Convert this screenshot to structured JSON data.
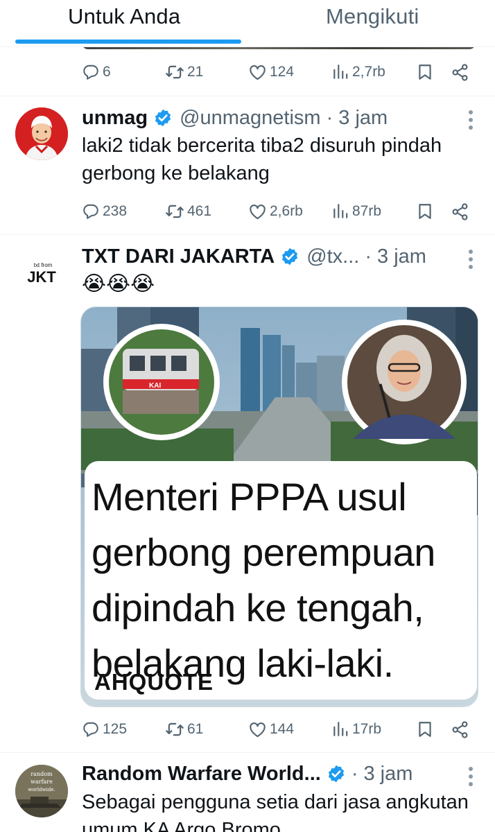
{
  "tabs": [
    {
      "label": "Untuk Anda",
      "active": true
    },
    {
      "label": "Mengikuti",
      "active": false
    }
  ],
  "accent_color": "#1d9bf0",
  "previous_tweet": {
    "actions": {
      "replies": "6",
      "retweets": "21",
      "likes": "124",
      "views": "2,7rb"
    }
  },
  "tweets": [
    {
      "display_name": "unmag",
      "verified": true,
      "handle": "@unmagnetism",
      "time": "3 jam",
      "text": "laki2 tidak bercerita tiba2 disuruh pindah gerbong ke belakang",
      "actions": {
        "replies": "238",
        "retweets": "461",
        "likes": "2,6rb",
        "views": "87rb"
      }
    },
    {
      "display_name": "TXT DARI JAKARTA",
      "verified": true,
      "handle": "@tx...",
      "time": "3 jam",
      "avatar_text": {
        "small": "txt from",
        "big": "JKT"
      },
      "text": "😭😭😭",
      "media": {
        "quote": "Menteri PPPA usul gerbong perempuan dipindah ke tengah, belakang laki-laki.",
        "brand": "AHQUOTE",
        "train_label": "KAI"
      },
      "actions": {
        "replies": "125",
        "retweets": "61",
        "likes": "144",
        "views": "17rb"
      }
    },
    {
      "display_name": "Random Warfare World...",
      "verified": true,
      "time": "3 jam",
      "avatar_text": "random warfare worldwide",
      "text": "Sebagai pengguna setia dari jasa angkutan umum KA Argo Bromo"
    }
  ],
  "icons": [
    "reply-icon",
    "retweet-icon",
    "like-icon",
    "views-icon",
    "bookmark-icon",
    "share-icon",
    "verified-icon",
    "more-icon"
  ]
}
